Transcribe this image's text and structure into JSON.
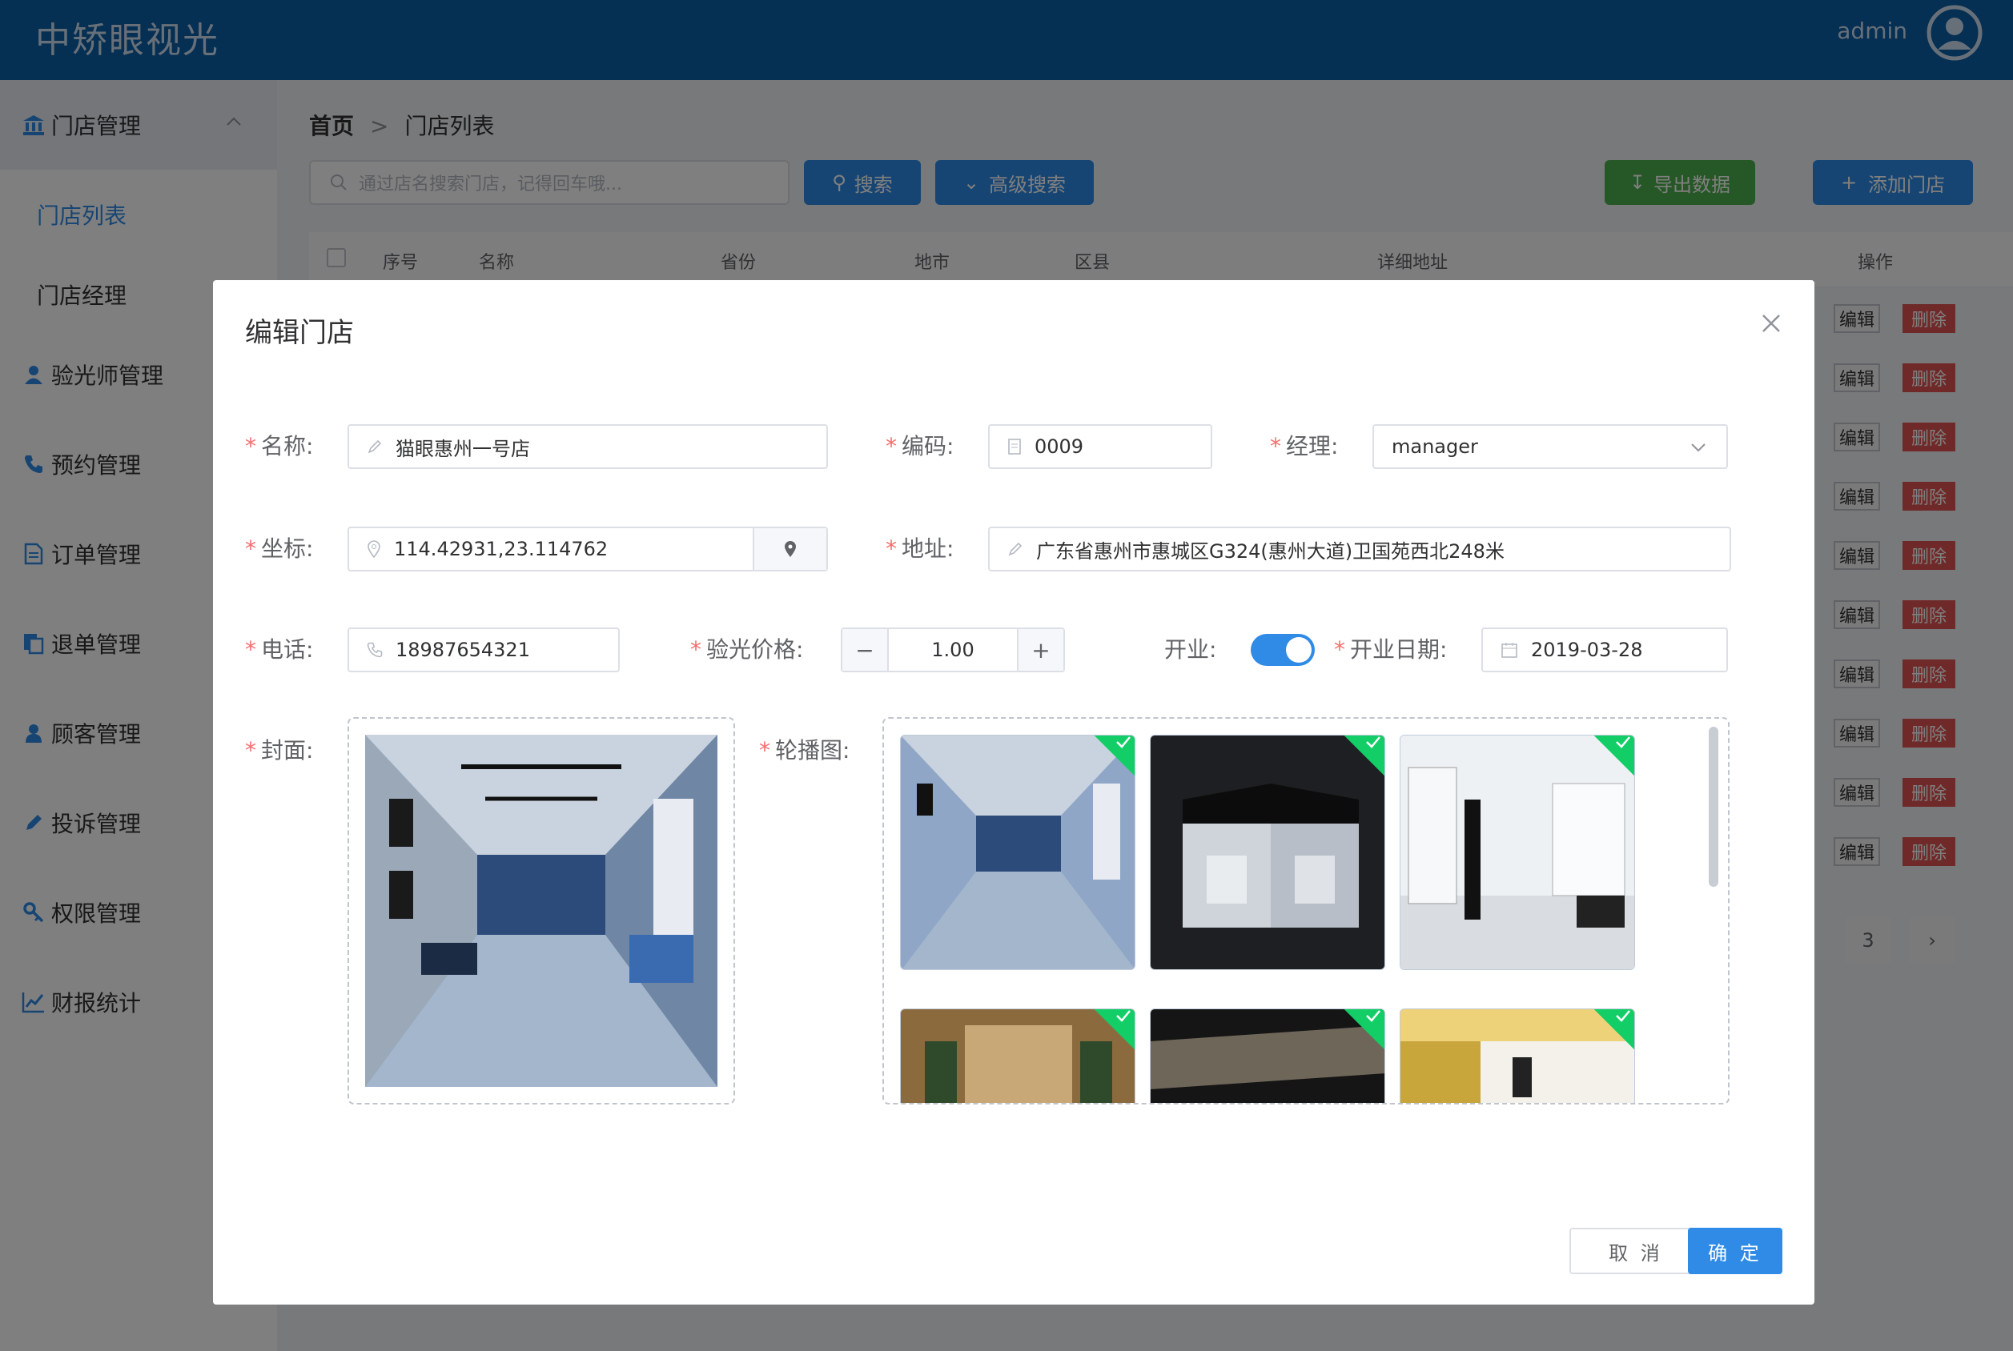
{
  "header": {
    "brand": "中矫眼视光",
    "user": "admin"
  },
  "sidebar": {
    "groups": [
      {
        "label": "门店管理",
        "icon": "bank-icon",
        "children": [
          "门店列表",
          "门店经理"
        ]
      },
      {
        "label": "验光师管理",
        "icon": "user-tie-icon"
      },
      {
        "label": "预约管理",
        "icon": "phone-icon"
      },
      {
        "label": "订单管理",
        "icon": "file-icon"
      },
      {
        "label": "退单管理",
        "icon": "copy-icon"
      },
      {
        "label": "顾客管理",
        "icon": "user-icon"
      },
      {
        "label": "投诉管理",
        "icon": "pen-icon"
      },
      {
        "label": "权限管理",
        "icon": "key-icon"
      },
      {
        "label": "财报统计",
        "icon": "chart-icon"
      }
    ]
  },
  "main": {
    "breadcrumb": {
      "home": "首页",
      "current": "门店列表"
    },
    "search_placeholder": "通过店名搜索门店，记得回车哦...",
    "search_btn": "搜索",
    "advanced_btn": "高级搜索",
    "export_btn": "导出数据",
    "add_btn": "添加门店",
    "table_headers": [
      "序号",
      "名称",
      "省份",
      "地市",
      "区县",
      "详细地址",
      "操作"
    ],
    "row_actions": {
      "edit": "编辑",
      "delete": "删除"
    },
    "pager_page": "3"
  },
  "dialog": {
    "title": "编辑门店",
    "fields": {
      "name": {
        "label": "名称:",
        "value": "猫眼惠州一号店"
      },
      "code": {
        "label": "编码:",
        "value": "0009"
      },
      "manager": {
        "label": "经理:",
        "value": "manager"
      },
      "coords": {
        "label": "坐标:",
        "value": "114.42931,23.114762"
      },
      "address": {
        "label": "地址:",
        "value": "广东省惠州市惠城区G324(惠州大道)卫国苑西北248米"
      },
      "phone": {
        "label": "电话:",
        "value": "18987654321"
      },
      "price": {
        "label": "验光价格:",
        "value": "1.00"
      },
      "open": {
        "label": "开业:",
        "on": true
      },
      "open_date": {
        "label": "开业日期:",
        "value": "2019-03-28"
      },
      "cover": {
        "label": "封面:"
      },
      "carousel": {
        "label": "轮播图:"
      }
    },
    "cancel": "取 消",
    "confirm": "确 定"
  },
  "colors": {
    "primary": "#2f8be6",
    "header": "#0a5ea6",
    "success": "#13ce66",
    "danger": "#e05252",
    "export": "#4cae4c"
  }
}
